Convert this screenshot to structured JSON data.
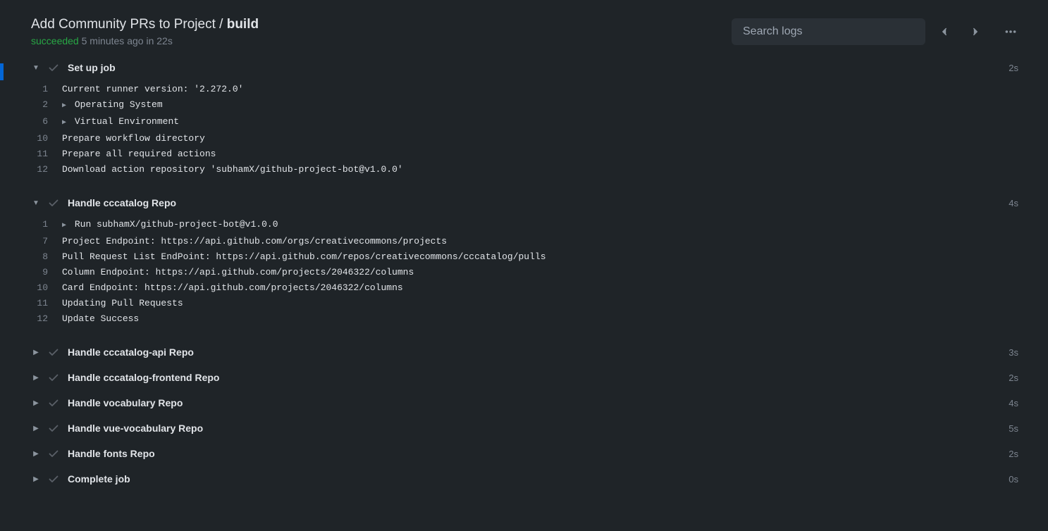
{
  "header": {
    "workflow_name": "Add Community PRs to Project",
    "separator": " / ",
    "job_name": "build",
    "status": "succeeded",
    "time_ago": "5 minutes ago",
    "in_word": "in",
    "duration": "22s",
    "search_placeholder": "Search logs"
  },
  "steps": [
    {
      "expanded": true,
      "title": "Set up job",
      "duration": "2s",
      "lines": [
        {
          "no": "1",
          "arrow": false,
          "text": "Current runner version: '2.272.0'"
        },
        {
          "no": "2",
          "arrow": true,
          "text": "Operating System"
        },
        {
          "no": "6",
          "arrow": true,
          "text": "Virtual Environment"
        },
        {
          "no": "10",
          "arrow": false,
          "text": "Prepare workflow directory"
        },
        {
          "no": "11",
          "arrow": false,
          "text": "Prepare all required actions"
        },
        {
          "no": "12",
          "arrow": false,
          "text": "Download action repository 'subhamX/github-project-bot@v1.0.0'"
        }
      ]
    },
    {
      "expanded": true,
      "title": "Handle cccatalog Repo",
      "duration": "4s",
      "lines": [
        {
          "no": "1",
          "arrow": true,
          "text": "Run subhamX/github-project-bot@v1.0.0"
        },
        {
          "no": "7",
          "arrow": false,
          "text": "Project Endpoint: https://api.github.com/orgs/creativecommons/projects"
        },
        {
          "no": "8",
          "arrow": false,
          "text": "Pull Request List EndPoint: https://api.github.com/repos/creativecommons/cccatalog/pulls"
        },
        {
          "no": "9",
          "arrow": false,
          "text": "Column Endpoint: https://api.github.com/projects/2046322/columns"
        },
        {
          "no": "10",
          "arrow": false,
          "text": "Card Endpoint: https://api.github.com/projects/2046322/columns"
        },
        {
          "no": "11",
          "arrow": false,
          "text": "Updating Pull Requests"
        },
        {
          "no": "12",
          "arrow": false,
          "text": "Update Success"
        }
      ]
    },
    {
      "expanded": false,
      "title": "Handle cccatalog-api Repo",
      "duration": "3s",
      "lines": []
    },
    {
      "expanded": false,
      "title": "Handle cccatalog-frontend Repo",
      "duration": "2s",
      "lines": []
    },
    {
      "expanded": false,
      "title": "Handle vocabulary Repo",
      "duration": "4s",
      "lines": []
    },
    {
      "expanded": false,
      "title": "Handle vue-vocabulary Repo",
      "duration": "5s",
      "lines": []
    },
    {
      "expanded": false,
      "title": "Handle fonts Repo",
      "duration": "2s",
      "lines": []
    },
    {
      "expanded": false,
      "title": "Complete job",
      "duration": "0s",
      "lines": []
    }
  ]
}
